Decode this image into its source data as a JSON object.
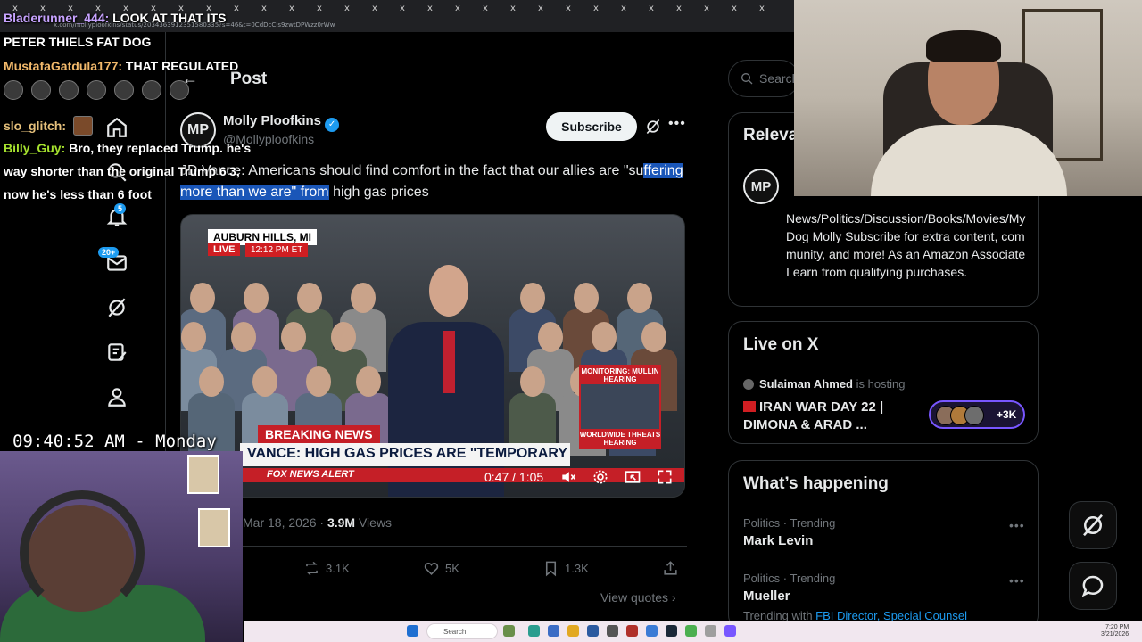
{
  "browser": {
    "url": "x.com/mollyploofkins/status/2034363912351580335?s=46&t=0CdDcCIs9zwtDPWzz0rWw",
    "tab_close_glyph": "x"
  },
  "nav": {
    "notifications_badge": "5",
    "messages_badge": "20+"
  },
  "post": {
    "header_title": "Post",
    "author_name": "Molly Ploofkins",
    "author_initials": "MP",
    "author_handle": "@Mollyploofkins",
    "subscribe_label": "Subscribe",
    "text_pre": "JD Vance: Americans should find comfort in the fact that our allies are \"su",
    "text_highlight": "ffering more than we are\" from",
    "text_post": " high gas prices",
    "date": "Mar 18, 2026",
    "views_count": "3.9M",
    "views_label": " Views",
    "retweets": "3.1K",
    "likes": "5K",
    "bookmarks": "1.3K",
    "view_quotes": "View quotes ›"
  },
  "video": {
    "location": "AUBURN HILLS, MI",
    "live": "LIVE",
    "live_time": "12:12 PM ET",
    "inset_top": "MONITORING: MULLIN HEARING",
    "inset_bottom": "WORLDWIDE THREATS HEARING",
    "breaking": "BREAKING NEWS",
    "chyron": "VANCE: HIGH GAS PRICES ARE \"TEMPORARY BLIP\"",
    "network_bar": "FOX NEWS ALERT",
    "time": "0:47 / 1:05"
  },
  "sidebar": {
    "search_placeholder": "Search",
    "relevant_title": "Relevant people",
    "relevant_initials": "MP",
    "relevant_bio": "News/Politics/Discussion/Books/Movies/My Dog Molly Subscribe for extra content, community, and more! As an Amazon Associate I earn from qualifying purchases.",
    "live_title": "Live on X",
    "live_host_name": "Sulaiman Ahmed",
    "live_host_suffix": " is hosting",
    "live_space_title": "IRAN WAR DAY 22 | DIMONA & ARAD ...",
    "live_count": "+3K",
    "happening_title": "What’s happening",
    "trends": [
      {
        "category": "Politics · Trending",
        "name": "Mark Levin"
      },
      {
        "category": "Politics · Trending",
        "name": "Mueller",
        "with_label": "Trending with ",
        "with_links": "FBI Director, Special Counsel"
      }
    ]
  },
  "chat": {
    "m1_user": "Bladerunner_444:",
    "m1_text": " LOOK AT THAT ITS",
    "m1_text2": "PETER THIELS FAT DOG",
    "m2_user": "MustafaGatdula177:",
    "m2_text": " THAT REGULATED",
    "m3_user": "slo_glitch:",
    "m4_user": "Billy_Guy:",
    "m4_line1": " Bro, they replaced Trump. he's",
    "m4_line2": "way shorter than the original Trump 6'3,",
    "m4_line3": "now he's less than 6 foot"
  },
  "clock": "09:40:52 AM - Monday",
  "taskbar": {
    "search": "Search",
    "time": "7:20 PM",
    "date": "3/21/2026"
  },
  "colors": {
    "accent": "#1d9bf0",
    "highlight": "#1a56b8",
    "breaking_red": "#c51f27",
    "live_pill": "#7856ff"
  }
}
